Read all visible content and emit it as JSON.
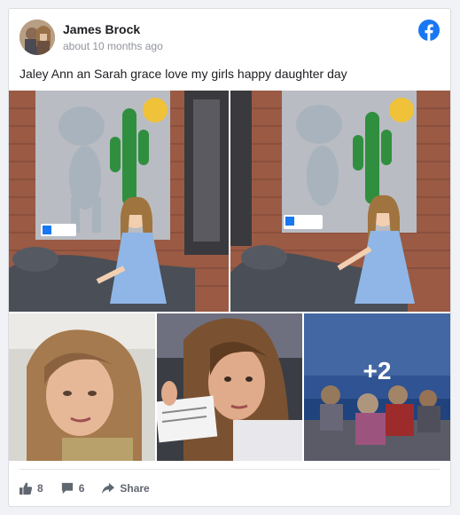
{
  "post": {
    "author": "James Brock",
    "timestamp": "about 10 months ago",
    "text": "Jaley Ann an Sarah grace love my girls happy daughter day",
    "more_photos": "+2"
  },
  "footer": {
    "likes": "8",
    "comments": "6",
    "share_label": "Share"
  },
  "icons": {
    "brand": "facebook-icon",
    "like": "thumbs-up-icon",
    "comment": "comment-bubble-icon",
    "share": "share-arrow-icon"
  },
  "colors": {
    "facebook_blue": "#1877f2",
    "action_gray": "#606770",
    "author_text": "#1c1e21",
    "timestamp_text": "#90949c"
  }
}
